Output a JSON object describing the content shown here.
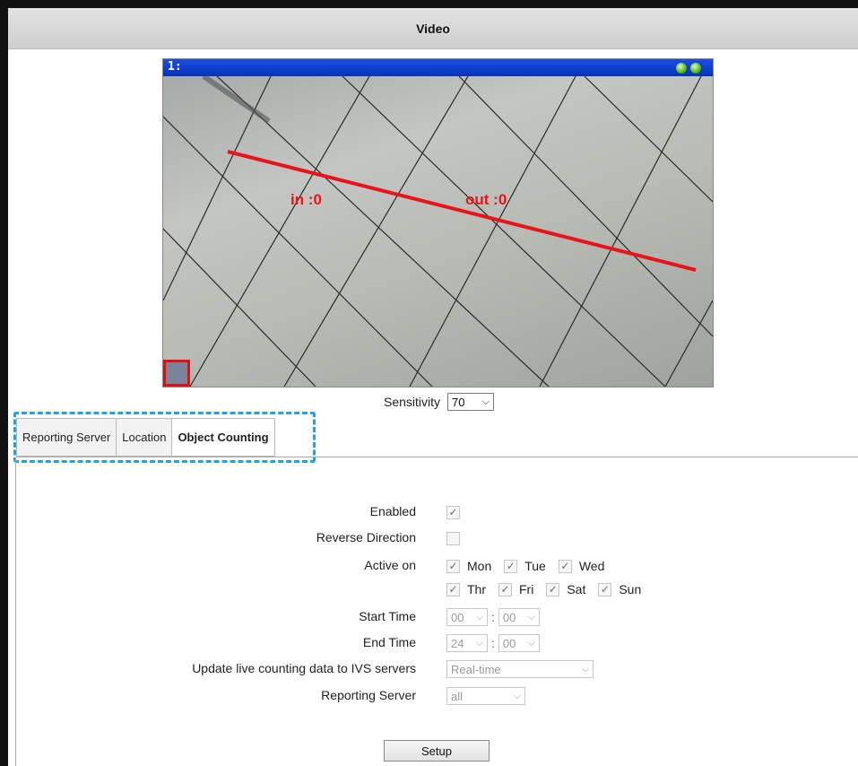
{
  "title": "Video",
  "video": {
    "channel": "1:",
    "in_label": "in :0",
    "out_label": "out :0"
  },
  "sensitivity": {
    "label": "Sensitivity",
    "value": "70"
  },
  "tabs": [
    {
      "label": "Reporting Server",
      "active": false
    },
    {
      "label": "Location",
      "active": false
    },
    {
      "label": "Object Counting",
      "active": true
    }
  ],
  "form": {
    "enabled": {
      "label": "Enabled",
      "checked": true
    },
    "reverse": {
      "label": "Reverse Direction",
      "checked": false
    },
    "active_on": {
      "label": "Active on",
      "row1": [
        {
          "day": "Mon",
          "checked": true
        },
        {
          "day": "Tue",
          "checked": true
        },
        {
          "day": "Wed",
          "checked": true
        }
      ],
      "row2": [
        {
          "day": "Thr",
          "checked": true
        },
        {
          "day": "Fri",
          "checked": true
        },
        {
          "day": "Sat",
          "checked": true
        },
        {
          "day": "Sun",
          "checked": true
        }
      ]
    },
    "start_time": {
      "label": "Start Time",
      "hour": "00",
      "minute": "00"
    },
    "end_time": {
      "label": "End Time",
      "hour": "24",
      "minute": "00"
    },
    "update_live": {
      "label": "Update live counting data to IVS servers",
      "value": "Real-time"
    },
    "reporting_server": {
      "label": "Reporting Server",
      "value": "all"
    }
  },
  "setup_button": "Setup",
  "colors": {
    "titlebar": "#d6d6d6",
    "video_bar": "#0b3fd0",
    "line": "#e8141b",
    "highlight": "#1fa3e6"
  }
}
